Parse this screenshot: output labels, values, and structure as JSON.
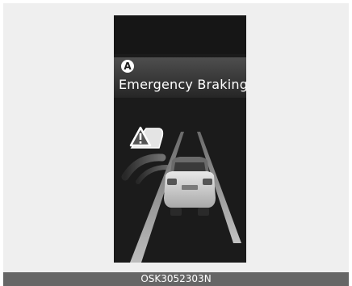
{
  "display": {
    "badge_label": "A",
    "warning_text": "Emergency Braking",
    "icons": [
      "forward-collision-warning-icon",
      "vehicle-ahead-icon"
    ]
  },
  "caption": {
    "code": "OSK3052303N"
  },
  "colors": {
    "screen_bg": "#1b1b1b",
    "panel_top": "#4e4e4e",
    "caption_bg": "#666666"
  }
}
